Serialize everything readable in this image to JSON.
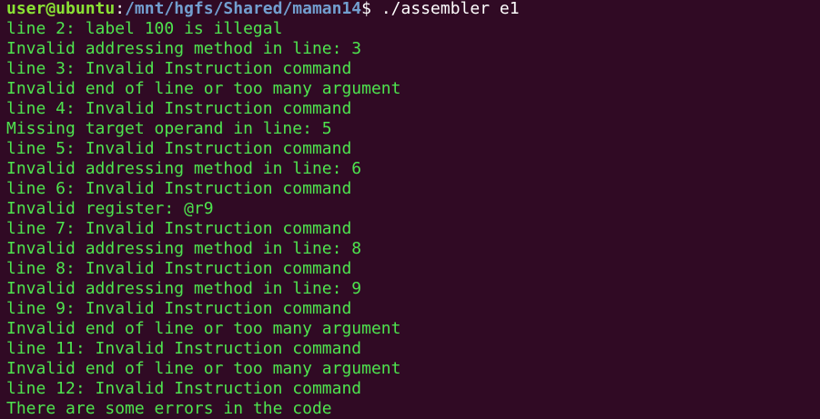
{
  "prompt": {
    "user_host": "user@ubuntu",
    "separator": ":",
    "path": "/mnt/hgfs/Shared/maman14",
    "symbol": "$ ",
    "command": "./assembler e1"
  },
  "output_lines": [
    "line 2: label 100 is illegal",
    "Invalid addressing method in line: 3",
    "line 3: Invalid Instruction command",
    "Invalid end of line or too many argument",
    "line 4: Invalid Instruction command",
    "Missing target operand in line: 5",
    "line 5: Invalid Instruction command",
    "Invalid addressing method in line: 6",
    "line 6: Invalid Instruction command",
    "Invalid register: @r9",
    "line 7: Invalid Instruction command",
    "Invalid addressing method in line: 8",
    "line 8: Invalid Instruction command",
    "Invalid addressing method in line: 9",
    "line 9: Invalid Instruction command",
    "Invalid end of line or too many argument",
    "line 11: Invalid Instruction command",
    "Invalid end of line or too many argument",
    "line 12: Invalid Instruction command",
    "There are some errors in the code"
  ],
  "colors": {
    "background": "#300a24",
    "output_text": "#4ee44e",
    "user_host": "#8ae234",
    "path": "#729fcf",
    "command": "#ffffff"
  }
}
